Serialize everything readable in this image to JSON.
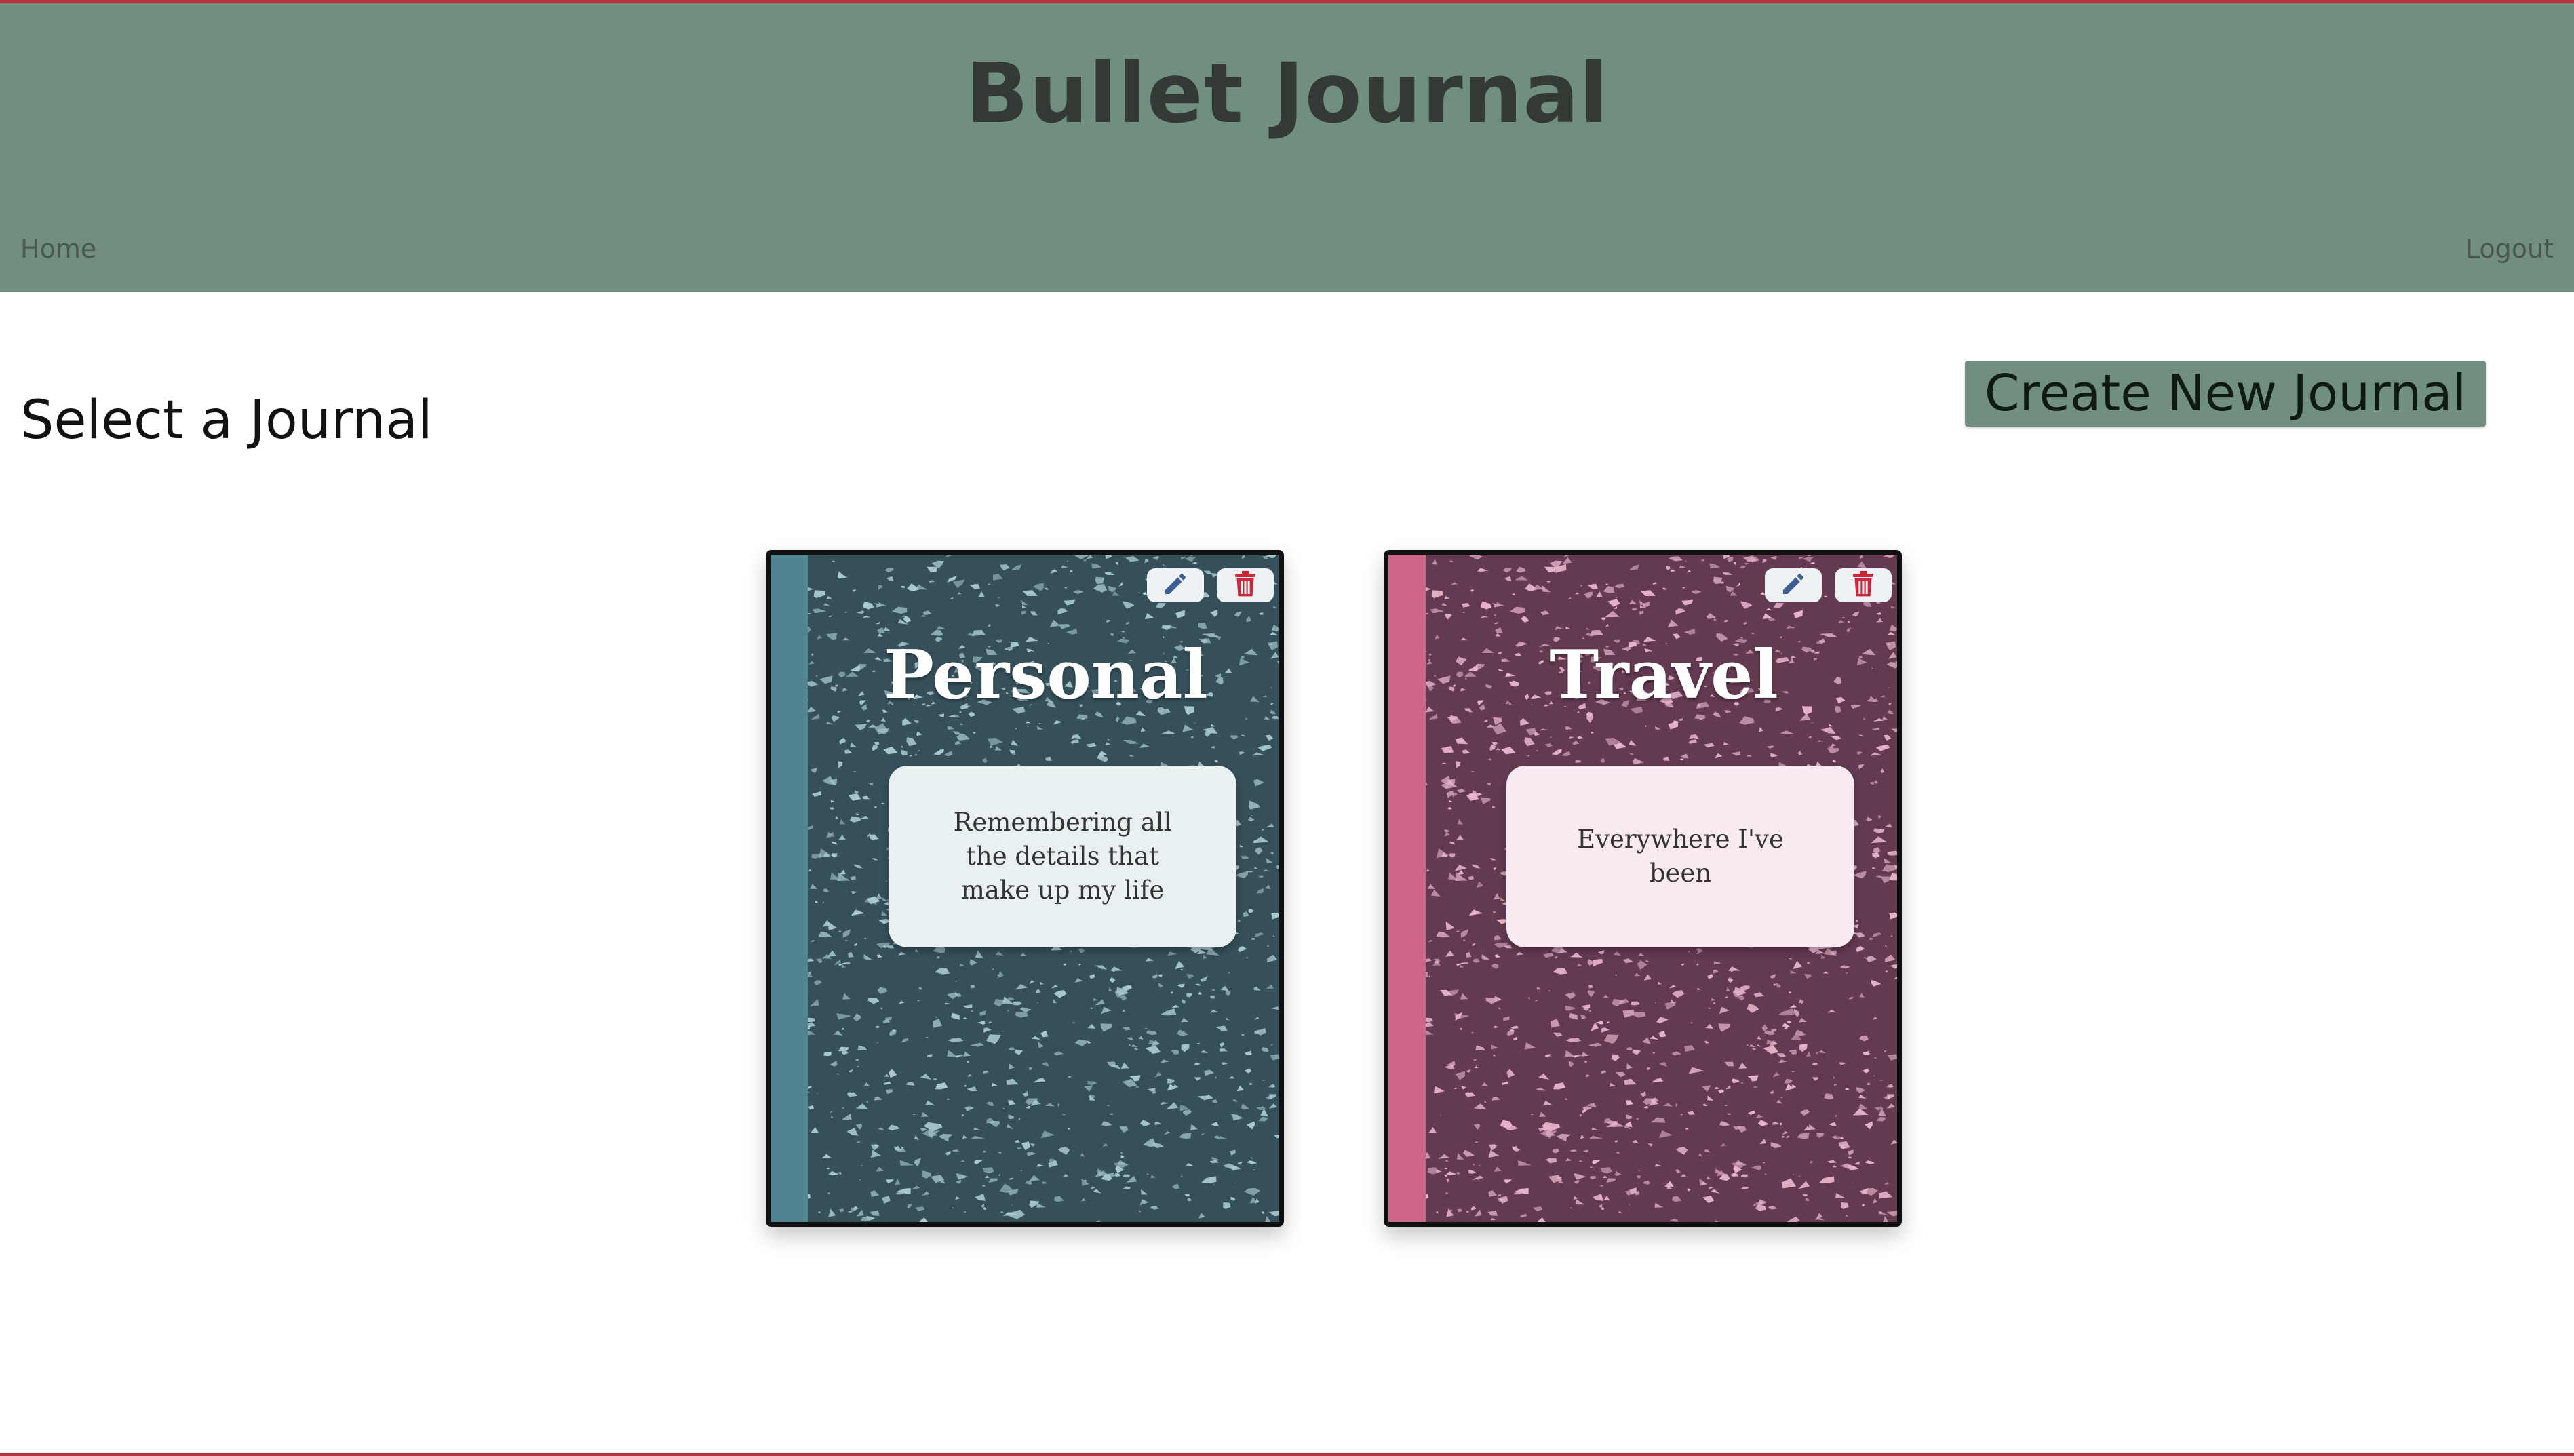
{
  "header": {
    "title": "Bullet Journal",
    "nav_home": "Home",
    "nav_logout": "Logout",
    "background_color": "#718f80"
  },
  "main": {
    "heading": "Select a Journal",
    "create_button": "Create New Journal"
  },
  "journals": [
    {
      "title": "Personal",
      "description": "Remembering all the details that make up my life",
      "cover_color": "#35505a",
      "speckle_color": "#a9c9cf",
      "spine_color": "#4f8590",
      "label_color": "#e9f0f1",
      "edit_icon": "pencil-icon",
      "delete_icon": "trash-icon"
    },
    {
      "title": "Travel",
      "description": "Everywhere I've been",
      "cover_color": "#633a50",
      "speckle_color": "#e8b4cc",
      "spine_color": "#cc6588",
      "label_color": "#f8eaf0",
      "edit_icon": "pencil-icon",
      "delete_icon": "trash-icon"
    }
  ]
}
